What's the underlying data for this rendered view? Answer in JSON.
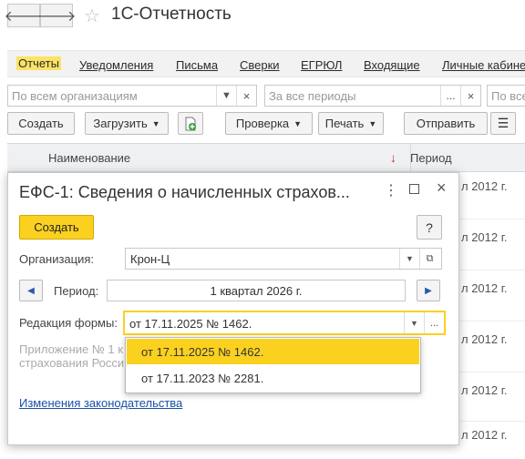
{
  "window": {
    "title": "1С-Отчетность"
  },
  "sections": [
    {
      "label": "Отчеты",
      "active": true
    },
    {
      "label": "Уведомления"
    },
    {
      "label": "Письма"
    },
    {
      "label": "Сверки"
    },
    {
      "label": "ЕГРЮЛ"
    },
    {
      "label": "Входящие"
    },
    {
      "label": "Личные кабинеты"
    }
  ],
  "filters": {
    "org_placeholder": "По всем организациям",
    "period_placeholder": "За все периоды",
    "third_placeholder": "По все"
  },
  "toolbar": {
    "create": "Создать",
    "load": "Загрузить",
    "check": "Проверка",
    "print": "Печать",
    "send": "Отправить"
  },
  "grid": {
    "col_name": "Наименование",
    "col_period": "Период",
    "period_values": [
      "л 2012 г.",
      "л 2012 г.",
      "л 2012 г.",
      "л 2012 г.",
      "л 2012 г.",
      "л 2012 г."
    ]
  },
  "dialog": {
    "title": "ЕФС-1: Сведения о начисленных страхов...",
    "create_button": "Создать",
    "help_button": "?",
    "org_label": "Организация:",
    "org_value": "Крон-Ц",
    "period_label": "Период:",
    "period_value": "1 квартал 2026 г.",
    "edition_label": "Редакция формы:",
    "edition_value": "от 17.11.2025 № 1462.",
    "note_line1": "Приложение № 1 к",
    "note_line2": "страхования Росси",
    "law_link": "Изменения законодательства"
  },
  "edition_options": [
    {
      "label": "от 17.11.2025 № 1462.",
      "selected": true
    },
    {
      "label": "от 17.11.2023 № 2281.",
      "selected": false
    }
  ],
  "colors": {
    "accent": "#fbd120",
    "link": "#1a4fa8"
  }
}
